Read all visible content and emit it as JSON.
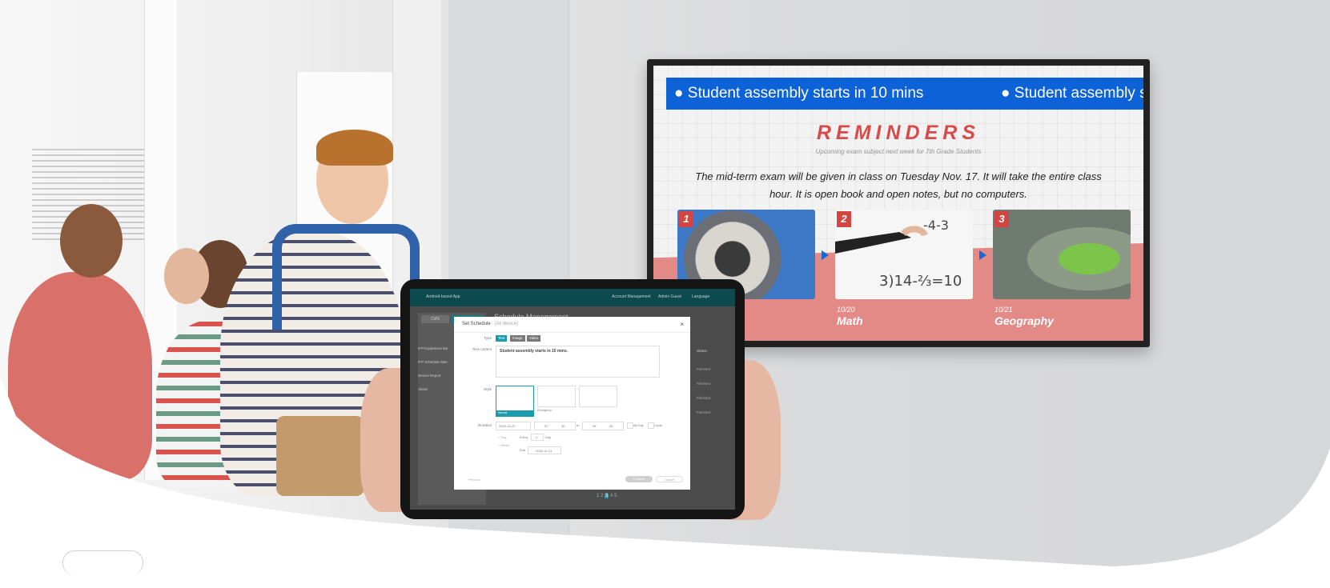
{
  "tv": {
    "ticker_items": [
      "Student assembly starts in 10 mins",
      "Student assembly sta"
    ],
    "title": "REMINDERS",
    "subtitle": "Upcoming exam subject next week for 7th Grade Students",
    "body": "The mid-term exam will be given in class on Tuesday Nov. 17. It will take the entire class hour. It is open book and open notes, but no computers.",
    "tiles": [
      {
        "num": "1",
        "date": "",
        "subject": ""
      },
      {
        "num": "2",
        "date": "10/20",
        "subject": "Math"
      },
      {
        "num": "3",
        "date": "10/21",
        "subject": "Geography"
      }
    ],
    "brand_color": "#0d62d8",
    "accent_color": "#d84a4a"
  },
  "tablet": {
    "app_title": "Android-based App",
    "top_links": [
      "Account Management",
      "Admin Guest",
      "Language"
    ],
    "sidebar_tabs": [
      "CMS",
      ""
    ],
    "sidebar_items": [
      "IFP Equipment Ma",
      "IFP Schedule Man",
      "Device Report",
      "About"
    ],
    "page_title": "Schedule Management",
    "table_header": "Status",
    "status_values": [
      "Finished",
      "Finished",
      "Finished",
      "Finished"
    ],
    "pagination": [
      "1",
      "2",
      "3",
      "4",
      "5"
    ],
    "dialog": {
      "title": "Set Schedule",
      "title_hint": "(All device)",
      "type_label": "Type",
      "type_options": [
        "Text",
        "Image",
        "Video"
      ],
      "text_content_label": "Text content",
      "text_content_value": "Student assembly starts in 10 mins.",
      "style_label": "Style",
      "style_options": [
        "Normal",
        "Emergency",
        ""
      ],
      "duration_label": "Duration",
      "start_date": "2020-10-22",
      "start_hour": "07",
      "start_minute": "30",
      "to_label": "to",
      "end_hour": "08",
      "end_minute": "00",
      "all_day_label": "All Day",
      "cycle_label": "Cycle",
      "repeat_options": [
        "Day",
        "Week"
      ],
      "every_label": "Every",
      "every_value": "1",
      "every_unit": "Day",
      "end_label": "End",
      "end_date": "2020-11-21",
      "preview_button": "Preview",
      "confirm_button": "Confirm",
      "cancel_button": "Cancel"
    }
  }
}
